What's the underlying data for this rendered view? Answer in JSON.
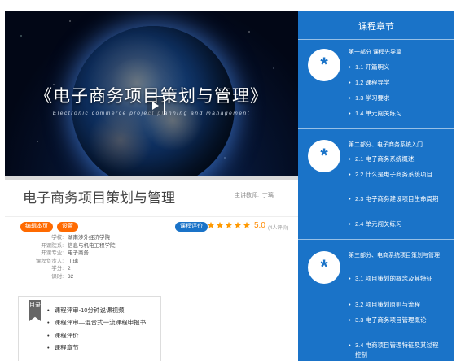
{
  "video": {
    "title": "《电子商务项目策划与管理》",
    "subtitle": "Electronic commerce project planning and management"
  },
  "course": {
    "title": "电子商务项目策划与管理",
    "teacher_label": "主讲教师:",
    "teacher_name": "丁璃"
  },
  "actions": {
    "edit_label": "编辑本页",
    "settings_label": "设置",
    "eval_label": "课程评价"
  },
  "rating": {
    "stars": 5,
    "score": "5.0",
    "count": "(4人评价)"
  },
  "meta": [
    {
      "label": "学校:",
      "value": "湖南涉外经济学院"
    },
    {
      "label": "开课院系:",
      "value": "信息与机电工程学院"
    },
    {
      "label": "开课专业:",
      "value": "电子商务"
    },
    {
      "label": "课程负责人:",
      "value": "丁璃"
    },
    {
      "label": "学分:",
      "value": "2"
    },
    {
      "label": "课时:",
      "value": "32"
    }
  ],
  "toc": {
    "badge": "目录",
    "items": [
      "课程评审-10分钟说课视频",
      "课程评审—混合式一流课程申报书",
      "课程评价",
      "课程章节"
    ]
  },
  "panel": {
    "title": "课程章节",
    "chapters": [
      {
        "icon": "*",
        "title": "第一部分 课程先导篇",
        "items": [
          "1.1 开篇明义",
          "1.2 课程导学",
          "1.3 学习要求",
          "1.4 单元闯关练习"
        ]
      },
      {
        "icon": "*",
        "title": "第二部分、电子商务系统入门",
        "items": [
          "2.1 电子商务系统概述",
          "2.2 什么是电子商务系统项目",
          "2.3 电子商务建设项目生命周期",
          "2.4 单元闯关练习"
        ]
      },
      {
        "icon": "*",
        "title": "第三部分、电商系统项目策划与管理",
        "items": [
          "3.1 项目策划的概念及其特征",
          "3.2 项目策划原则与流程",
          "3.3 电子商务项目管理概论",
          "3.4 电商项目管理特征及其过程控制"
        ]
      }
    ]
  },
  "colors": {
    "panel_blue": "#1a73c8",
    "orange": "#ff6a00",
    "star": "#ff9900"
  }
}
